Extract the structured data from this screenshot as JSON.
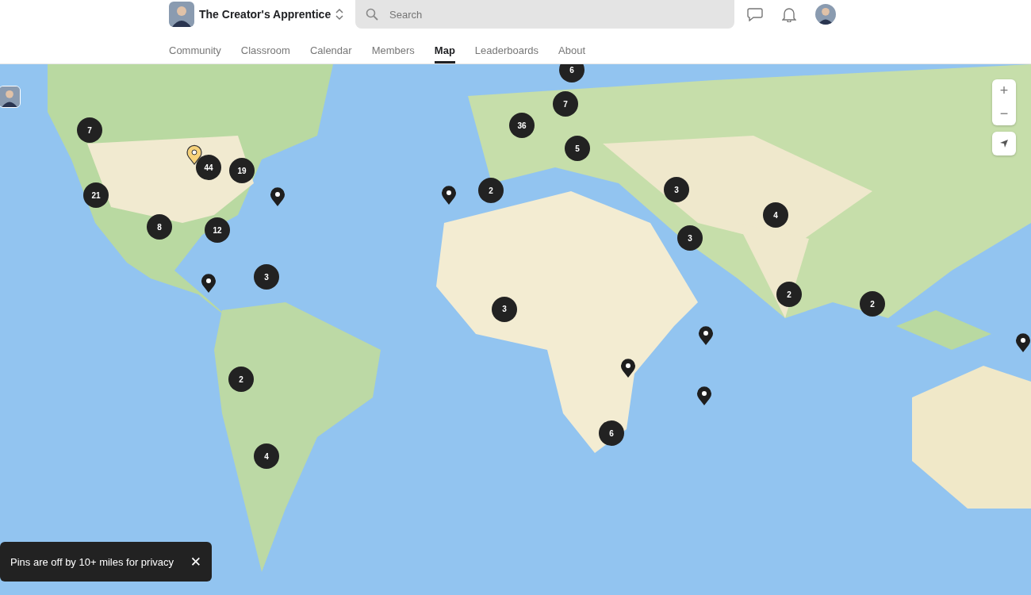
{
  "header": {
    "group_name": "The Creator's Apprentice",
    "search": {
      "placeholder": "Search"
    }
  },
  "tabs": [
    {
      "label": "Community",
      "selected": false
    },
    {
      "label": "Classroom",
      "selected": false
    },
    {
      "label": "Calendar",
      "selected": false
    },
    {
      "label": "Members",
      "selected": false
    },
    {
      "label": "Map",
      "selected": true
    },
    {
      "label": "Leaderboards",
      "selected": false
    },
    {
      "label": "About",
      "selected": false
    }
  ],
  "map": {
    "markers": [
      {
        "kind": "cluster",
        "count": "6"
      },
      {
        "kind": "cluster",
        "count": "7"
      },
      {
        "kind": "cluster",
        "count": "44"
      },
      {
        "kind": "cluster",
        "count": "19"
      },
      {
        "kind": "cluster",
        "count": "21"
      },
      {
        "kind": "cluster",
        "count": "8"
      },
      {
        "kind": "cluster",
        "count": "12"
      },
      {
        "kind": "cluster",
        "count": "3"
      },
      {
        "kind": "cluster",
        "count": "2"
      },
      {
        "kind": "cluster",
        "count": "4"
      },
      {
        "kind": "cluster",
        "count": "36"
      },
      {
        "kind": "cluster",
        "count": "7"
      },
      {
        "kind": "cluster",
        "count": "5"
      },
      {
        "kind": "cluster",
        "count": "2"
      },
      {
        "kind": "cluster",
        "count": "3"
      },
      {
        "kind": "cluster",
        "count": "3"
      },
      {
        "kind": "cluster",
        "count": "4"
      },
      {
        "kind": "cluster",
        "count": "2"
      },
      {
        "kind": "cluster",
        "count": "2"
      },
      {
        "kind": "cluster",
        "count": "3"
      },
      {
        "kind": "cluster",
        "count": "6"
      },
      {
        "kind": "pin"
      },
      {
        "kind": "pin"
      },
      {
        "kind": "pin"
      },
      {
        "kind": "pin"
      },
      {
        "kind": "pin"
      },
      {
        "kind": "pin"
      },
      {
        "kind": "pin"
      },
      {
        "kind": "own-pin"
      },
      {
        "kind": "avatar"
      }
    ],
    "zoom_in": "+",
    "zoom_out": "−"
  },
  "toast": {
    "text": "Pins are off by 10+ miles for privacy",
    "close": "✕"
  }
}
